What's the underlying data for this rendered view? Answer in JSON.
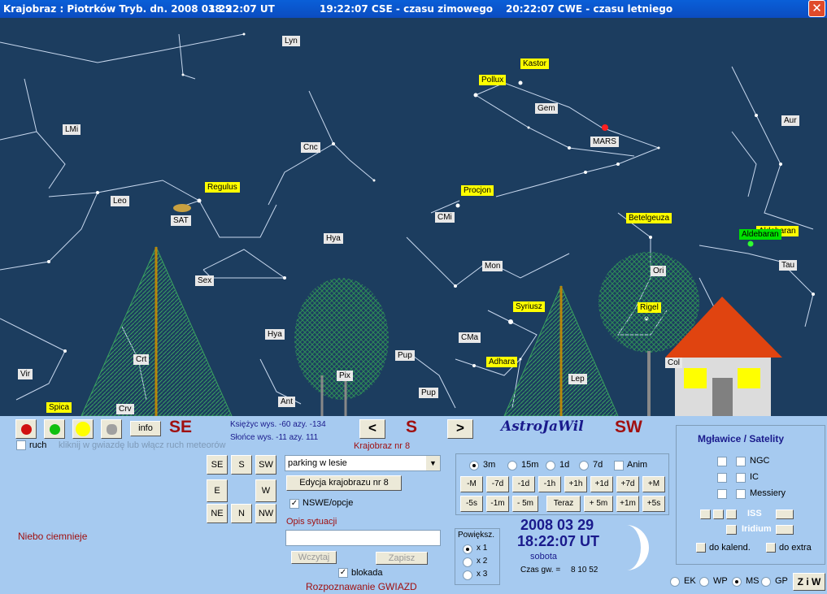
{
  "title": {
    "app": "Krajobraz : Piotrków Tryb. dn. 2008 03 29",
    "ut": "18:22:07 UT",
    "cse": "19:22:07 CSE - czasu zimowego",
    "cwe": "20:22:07 CWE - czasu letniego",
    "close": "✕"
  },
  "sky": {
    "constellations": [
      "Lyn",
      "LMi",
      "Cnc",
      "Gem",
      "Aur",
      "Leo",
      "CMi",
      "Hya",
      "Mon",
      "Sex",
      "Hya",
      "Tau",
      "Ori",
      "CMa",
      "Pup",
      "Pup",
      "Lep",
      "Crt",
      "Vir",
      "Ant",
      "Crv",
      "Pix",
      "Col"
    ],
    "stars": [
      "Kastor",
      "Pollux",
      "Regulus",
      "Procjon",
      "Betelgeuza",
      "Aldebaran",
      "Syriusz",
      "Adhara",
      "Rigel",
      "Spica"
    ],
    "objects": [
      "MARS",
      "SAT"
    ],
    "aldebaran_green": "Aldebaran"
  },
  "panel": {
    "direction_left": "SE",
    "direction_center": "S",
    "direction_right": "SW",
    "info_btn": "info",
    "ruch_label": "ruch",
    "meteor_hint": "kliknij w gwiazdę lub włącz ruch meteorów",
    "moon_info": "Księżyc wys. -60   azy. -134",
    "sun_info": "Słońce wys. -11   azy. 111",
    "prev_btn": "<",
    "next_btn": ">",
    "krajobraz_nr": "Krajobraz nr 8",
    "brand": "AstroJaWil",
    "dir_buttons": [
      "SE",
      "S",
      "SW",
      "E",
      "W",
      "NE",
      "N",
      "NW"
    ],
    "landscape_select": "parking w lesie",
    "edit_btn": "Edycja krajobrazu nr 8",
    "nswe_label": "NSWE/opcje",
    "opis_label": "Opis sytuacji",
    "opis_value": "",
    "wczytaj_btn": "Wczytaj",
    "zapisz_btn": "Zapisz",
    "blokada_label": "blokada",
    "rozpoznawanie": "Rozpoznawanie GWIAZD",
    "status": "Niebo ciemnieje",
    "steps": [
      "3m",
      "15m",
      "1d",
      "7d"
    ],
    "anim_label": "Anim",
    "row1": [
      "-M",
      "-7d",
      "-1d",
      "-1h",
      "+1h",
      "+1d",
      "+7d",
      "+M"
    ],
    "row2": [
      "-5s",
      "-1m",
      "- 5m",
      "Teraz",
      "+ 5m",
      "+1m",
      "+5s"
    ],
    "zoom_title": "Powiększ.",
    "zoom_opts": [
      "x 1",
      "x 2",
      "x 3"
    ],
    "date": "2008 03 29",
    "time": "18:22:07 UT",
    "day": "sobota",
    "czas_gw_label": "Czas gw. =",
    "czas_gw_value": "8 10 52",
    "mglawice_title": "Mgławice / Satelity",
    "ngc": "NGC",
    "ic": "IC",
    "messiery": "Messiery",
    "iss": "ISS",
    "iridium": "Iridium",
    "do_kalend": "do kalend.",
    "do_extra": "do extra",
    "modes": [
      "EK",
      "WP",
      "MS",
      "GP"
    ],
    "ziw": "Z i W"
  },
  "colors": {
    "sky": "#1c3d5f",
    "star_label": "#ffff00",
    "panel": "#a6caf0",
    "direction": "#a01010",
    "brand": "#1a1a8c"
  }
}
